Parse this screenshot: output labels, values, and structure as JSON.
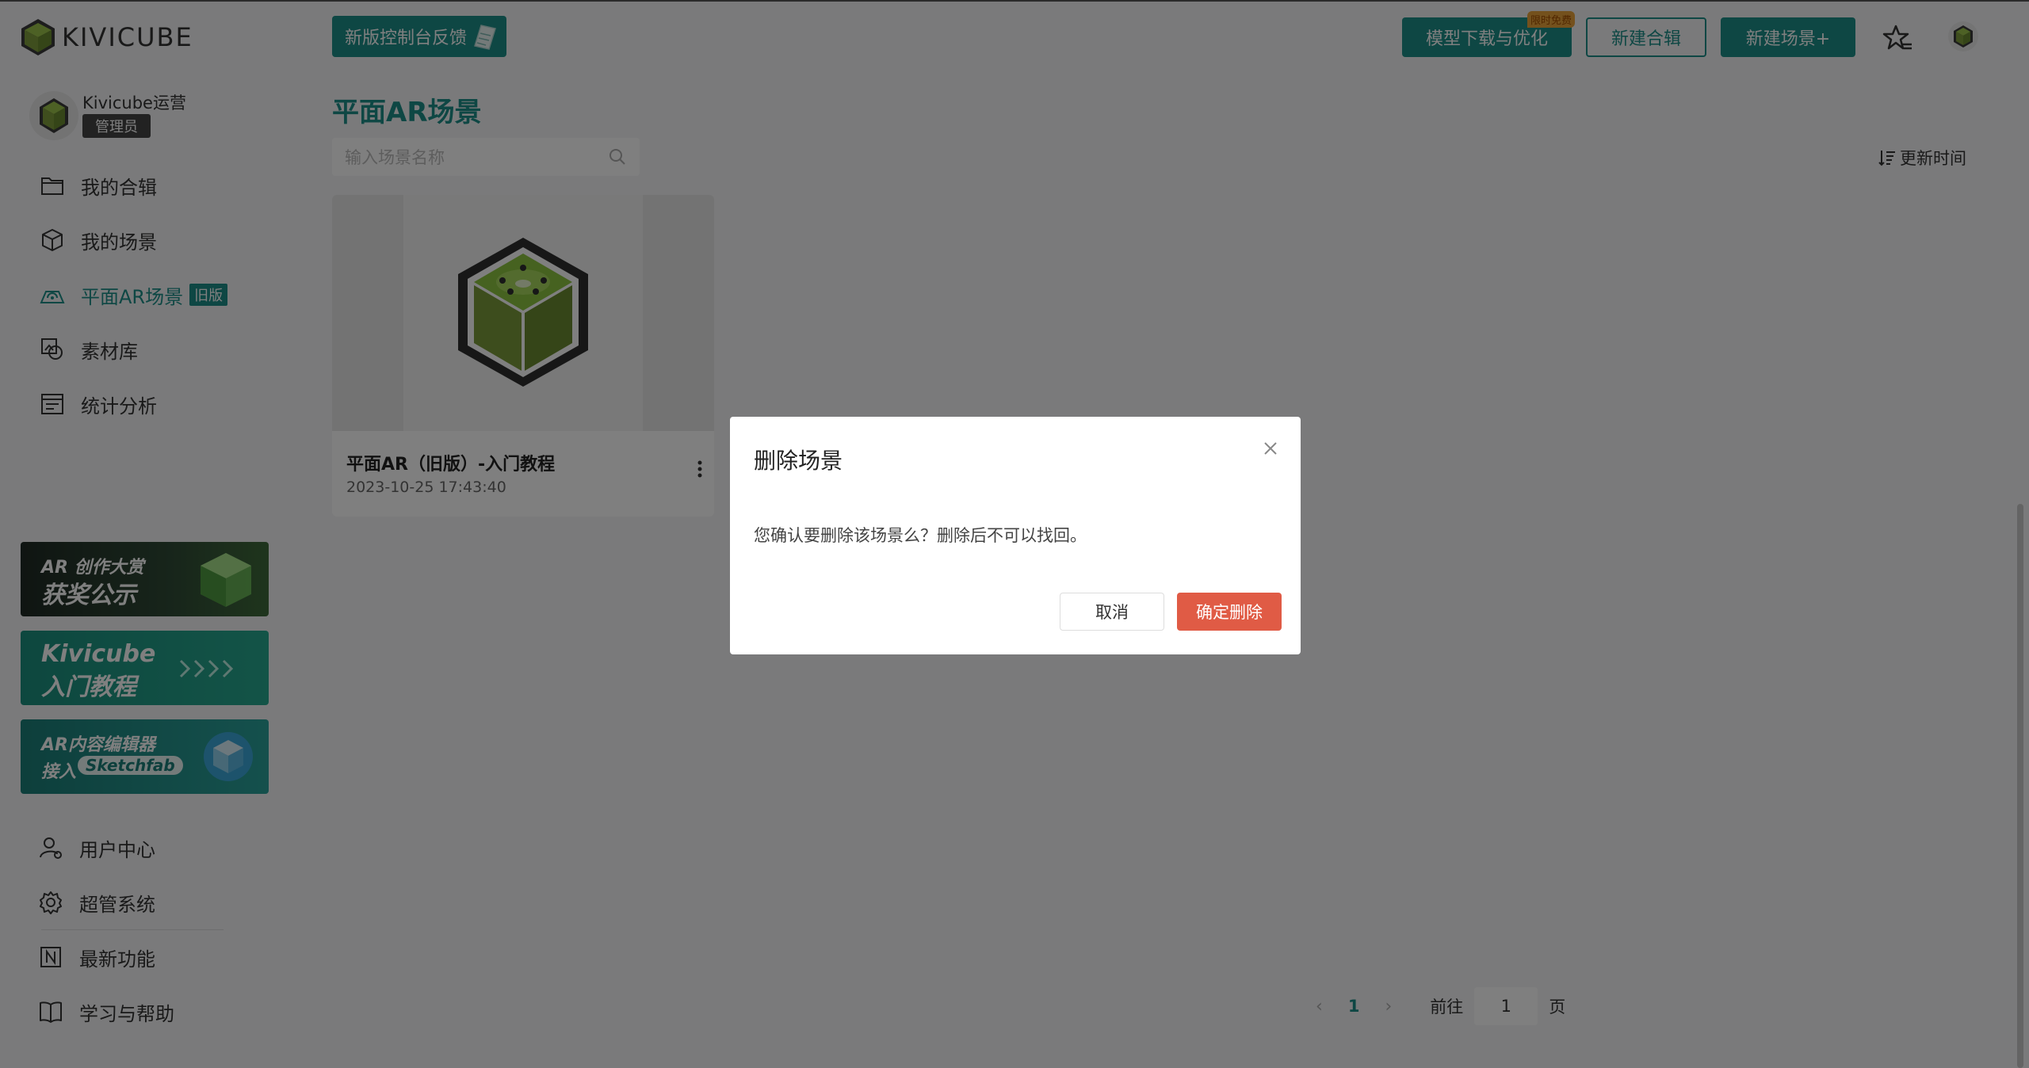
{
  "header": {
    "logo_text": "KIVICUBE",
    "feedback_label": "新版控制台反馈",
    "download_label": "模型下载与优化",
    "download_tag": "限时免费",
    "new_collection_label": "新建合辑",
    "new_scene_label": "新建场景+"
  },
  "sidebar": {
    "user_name": "Kivicube运营",
    "user_role": "管理员",
    "nav": [
      {
        "label": "我的合辑",
        "icon": "folder-icon"
      },
      {
        "label": "我的场景",
        "icon": "cube-icon"
      },
      {
        "label": "平面AR场景",
        "icon": "ar-plane-icon",
        "badge": "旧版"
      },
      {
        "label": "素材库",
        "icon": "assets-icon"
      },
      {
        "label": "统计分析",
        "icon": "analytics-icon"
      }
    ],
    "banners": [
      {
        "line1": "AR 创作大赏",
        "line2": "获奖公示"
      },
      {
        "line1": "Kivicube",
        "line2": "入门教程"
      },
      {
        "line1": "AR内容编辑器",
        "line2": "接入",
        "pill": "Sketchfab"
      }
    ],
    "bottom_nav": [
      {
        "label": "用户中心",
        "icon": "user-center-icon"
      },
      {
        "label": "超管系统",
        "icon": "settings-icon"
      },
      {
        "label": "最新功能",
        "icon": "new-feature-icon"
      },
      {
        "label": "学习与帮助",
        "icon": "book-icon"
      }
    ]
  },
  "main": {
    "title": "平面AR场景",
    "search_placeholder": "输入场景名称",
    "sort_label": "更新时间",
    "cards": [
      {
        "title": "平面AR（旧版）-入门教程",
        "date": "2023-10-25 17:43:40"
      }
    ],
    "pagination": {
      "current": "1",
      "goto_label": "前往",
      "goto_value": "1",
      "page_suffix": "页"
    }
  },
  "dialog": {
    "title": "删除场景",
    "message": "您确认要删除该场景么？删除后不可以找回。",
    "cancel_label": "取消",
    "confirm_label": "确定删除"
  },
  "colors": {
    "brand": "#1c8f89",
    "danger": "#e05b45",
    "overlay": "rgba(0,0,0,0.5)"
  }
}
